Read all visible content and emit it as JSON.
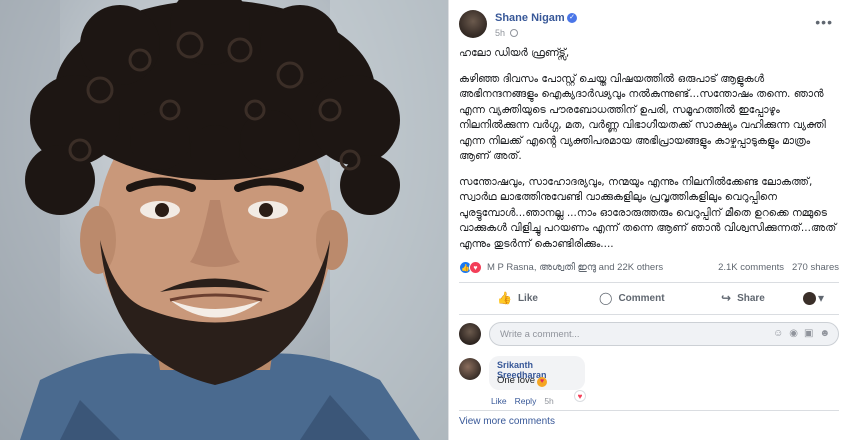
{
  "post": {
    "author": "Shane Nigam",
    "time": "5h",
    "paragraphs": [
      "ഹലോ ഡിയർ ഫ്രണ്ട്സ്,",
      "കഴിഞ്ഞ ദിവസം പോസ്റ്റ് ചെയ്ത വിഷയത്തിൽ ഒരുപാട് ആളുകൾ അഭിനന്ദനങ്ങളും ഐക്യദാർഢ്യവും നൽകുന്നുണ്ട്...സന്തോഷം തന്നെ. ഞാൻ എന്ന വ്യക്തിയുടെ പൗരബോധത്തിന് ഉപരി, സമൂഹത്തിൽ ഇപ്പോഴും നിലനിൽക്കുന്ന വർഗ്ഗ, മത, വർണ്ണ വിഭാഗീയതക്ക് സാക്ഷ്യം വഹിക്കുന്ന വ്യക്തി എന്ന നിലക്ക് എൻ്റെ വ്യക്തിപരമായ അഭിപ്രായങ്ങളും കാഴ്ചപ്പാടുകളും മാത്രം ആണ് അത്.",
      "സന്തോഷവും, സാഹോദര്യവും, നന്മയും എന്നും നിലനിൽക്കേണ്ട ലോകത്ത്, സ്വാർഥ ലാഭത്തിനുവേണ്ടി വാക്കുകളിലും പ്രവൃത്തികളിലും വെറുപ്പിനെ പുരട്ടുമ്പോൾ...ഞാനല്ല ...നാം ഓരോരുത്തരും വെറുപ്പിന് മീതെ ഉറക്കെ നമ്മുടെ വാക്കുകൾ വിളിച്ചു പറയണം എന്ന് തന്നെ ആണ് ഞാൻ വിശ്വസിക്കുന്നത്...അത് എന്നും തുടർന്ന് കൊണ്ടിരിക്കും...."
    ]
  },
  "stats": {
    "reactors": "M P Rasna, അശ്വതി ഇന്ദു and 22K others",
    "comments": "2.1K comments",
    "shares": "270 shares"
  },
  "actions": {
    "like": "Like",
    "comment": "Comment",
    "share": "Share"
  },
  "composer": {
    "placeholder": "Write a comment..."
  },
  "reply": {
    "name": "Srikanth Sreedharan",
    "text": "One love",
    "like": "Like",
    "reply": "Reply",
    "time": "5h"
  },
  "view_more": "View more comments",
  "colors": {
    "link": "#385898",
    "like_reaction": "#1877f2",
    "love_reaction": "#f33e58",
    "muted": "#606770"
  },
  "icons": [
    "verified-badge-icon",
    "globe-icon",
    "more-options-icon",
    "like-icon",
    "comment-icon",
    "share-icon",
    "emoji-icon",
    "camera-icon",
    "gif-icon",
    "sticker-icon",
    "love-reaction-icon"
  ]
}
